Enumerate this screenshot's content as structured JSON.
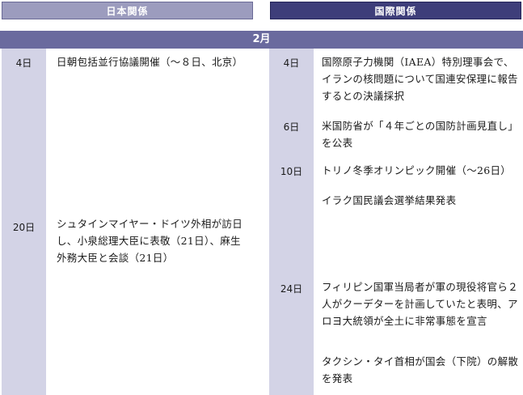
{
  "headers": {
    "japan": "日本関係",
    "international": "国際関係"
  },
  "month": "2月",
  "japan": [
    {
      "date": "4日",
      "text": "日朝包括並行協議開催（～８日、北京）"
    },
    {
      "date": "20日",
      "text": "シュタインマイヤー・ドイツ外相が訪日し、小泉総理大臣に表敬（21日）、麻生外務大臣と会談（21日）"
    }
  ],
  "international": [
    {
      "date": "4日",
      "text": "国際原子力機関（IAEA）特別理事会で、イランの核問題について国連安保理に報告するとの決議採択"
    },
    {
      "date": "6日",
      "text": "米国防省が「４年ごとの国防計画見直し」を公表"
    },
    {
      "date": "10日",
      "text": "トリノ冬季オリンピック開催（～26日）"
    },
    {
      "date": "",
      "text": "イラク国民議会選挙結果発表"
    },
    {
      "date": "24日",
      "text": "フィリピン国軍当局者が軍の現役将官ら２人がクーデターを計画していたと表明、アロヨ大統領が全土に非常事態を宣言"
    },
    {
      "date": "",
      "text": "タクシン・タイ首相が国会（下院）の解散を発表"
    }
  ]
}
